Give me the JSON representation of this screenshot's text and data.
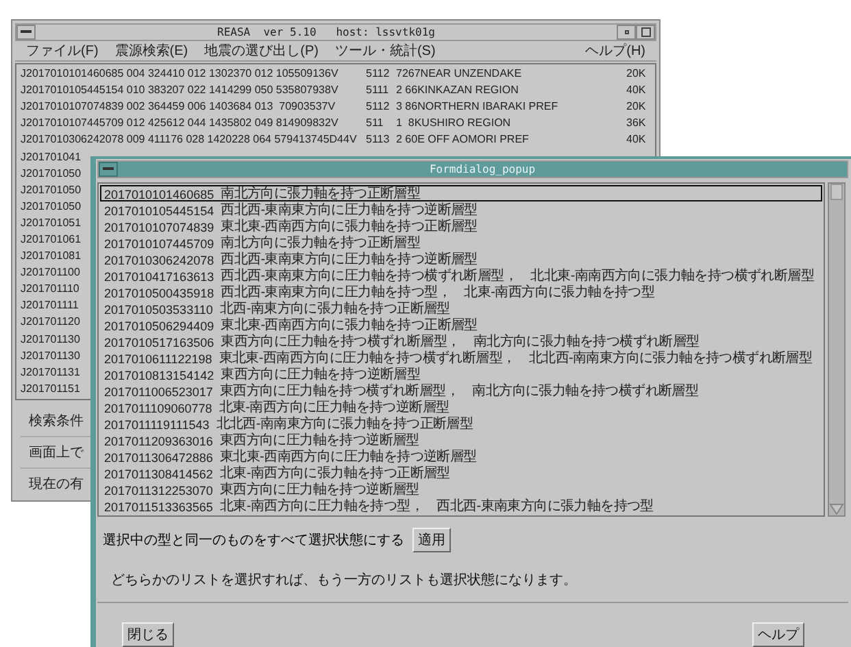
{
  "main_window": {
    "title": "REASA  ver 5.10   host: lssvtk01g",
    "menu": [
      {
        "label": "ファイル(F)"
      },
      {
        "label": "震源検索(E)"
      },
      {
        "label": "地震の選び出し(P)"
      },
      {
        "label": "ツール・統計(S)"
      }
    ],
    "help_menu": "ヘルプ(H)",
    "rows": [
      {
        "kind": "full",
        "data": "J2017010101460685 004 324410 012 1302370 012 105509136V",
        "code": "5112",
        "region": "7267NEAR UNZENDAKE",
        "size": "20K"
      },
      {
        "kind": "full",
        "data": "J2017010105445154 010 383207 022 1414299 050 535807938V",
        "code": "5111",
        "region": "2 66KINKAZAN REGION",
        "size": "40K"
      },
      {
        "kind": "full",
        "data": "J2017010107074839 002 364459 006 1403684 013  70903537V",
        "code": "5112",
        "region": "3 86NORTHERN IBARAKI PREF",
        "size": "20K"
      },
      {
        "kind": "full",
        "data": "J2017010107445709 012 425612 044 1435802 049 814909832V",
        "code": "511",
        "region": "1  8KUSHIRO REGION",
        "size": "36K"
      },
      {
        "kind": "full",
        "data": "J2017010306242078 009 411176 028 1420228 064 579413745D44V",
        "code": "5113",
        "region": "2 60E OFF AOMORI PREF",
        "size": "40K"
      },
      {
        "kind": "partial",
        "data": "J201701041"
      },
      {
        "kind": "partial",
        "data": "J201701050"
      },
      {
        "kind": "partial",
        "data": "J201701050"
      },
      {
        "kind": "partial",
        "data": "J201701050"
      },
      {
        "kind": "partial",
        "data": "J201701051"
      },
      {
        "kind": "partial",
        "data": "J201701061"
      },
      {
        "kind": "partial",
        "data": "J201701081"
      },
      {
        "kind": "partial",
        "data": "J201701100"
      },
      {
        "kind": "partial",
        "data": "J201701110"
      },
      {
        "kind": "partial",
        "data": "J201701111"
      },
      {
        "kind": "partial",
        "data": "J201701120"
      },
      {
        "kind": "partial",
        "data": "J201701130"
      },
      {
        "kind": "partial",
        "data": "J201701130"
      },
      {
        "kind": "partial",
        "data": "J201701131"
      },
      {
        "kind": "partial",
        "data": "J201701151"
      }
    ],
    "labels": [
      "検索条件",
      "画面上で",
      "現在の有"
    ]
  },
  "popup": {
    "title": "Formdialog_popup",
    "rows": [
      {
        "id": "2017010101460685",
        "type": "南北方向に張力軸を持つ正断層型",
        "focused": true
      },
      {
        "id": "2017010105445154",
        "type": "西北西-東南東方向に圧力軸を持つ逆断層型",
        "focused": false
      },
      {
        "id": "2017010107074839",
        "type": "東北東-西南西方向に張力軸を持つ正断層型",
        "focused": false
      },
      {
        "id": "2017010107445709",
        "type": "南北方向に張力軸を持つ正断層型",
        "focused": false
      },
      {
        "id": "2017010306242078",
        "type": "西北西-東南東方向に圧力軸を持つ逆断層型",
        "focused": false
      },
      {
        "id": "2017010417163613",
        "type": "西北西-東南東方向に圧力軸を持つ横ずれ断層型，　北北東-南南西方向に張力軸を持つ横ずれ断層型",
        "focused": false
      },
      {
        "id": "2017010500435918",
        "type": "西北西-東南東方向に圧力軸を持つ型，　北東-南西方向に張力軸を持つ型",
        "focused": false
      },
      {
        "id": "2017010503533110",
        "type": "北西-南東方向に張力軸を持つ正断層型",
        "focused": false
      },
      {
        "id": "2017010506294409",
        "type": "東北東-西南西方向に張力軸を持つ正断層型",
        "focused": false
      },
      {
        "id": "2017010517163506",
        "type": "東西方向に圧力軸を持つ横ずれ断層型，　南北方向に張力軸を持つ横ずれ断層型",
        "focused": false
      },
      {
        "id": "2017010611122198",
        "type": "東北東-西南西方向に圧力軸を持つ横ずれ断層型，　北北西-南南東方向に張力軸を持つ横ずれ断層型",
        "focused": false
      },
      {
        "id": "2017010813154142",
        "type": "東西方向に圧力軸を持つ逆断層型",
        "focused": false
      },
      {
        "id": "2017011006523017",
        "type": "東西方向に圧力軸を持つ横ずれ断層型，　南北方向に張力軸を持つ横ずれ断層型",
        "focused": false
      },
      {
        "id": "2017011109060778",
        "type": "北東-南西方向に圧力軸を持つ逆断層型",
        "focused": false
      },
      {
        "id": "2017011119111543",
        "type": "北北西-南南東方向に張力軸を持つ正断層型",
        "focused": false
      },
      {
        "id": "2017011209363016",
        "type": "東西方向に圧力軸を持つ逆断層型",
        "focused": false
      },
      {
        "id": "2017011306472886",
        "type": "東北東-西南西方向に圧力軸を持つ逆断層型",
        "focused": false
      },
      {
        "id": "2017011308414562",
        "type": "北東-南西方向に張力軸を持つ正断層型",
        "focused": false
      },
      {
        "id": "2017011312253070",
        "type": "東西方向に圧力軸を持つ逆断層型",
        "focused": false
      },
      {
        "id": "2017011513363565",
        "type": "北東-南西方向に圧力軸を持つ型，　西北西-東南東方向に張力軸を持つ型",
        "focused": false
      }
    ],
    "apply_label": "選択中の型と同一のものをすべて選択状態にする",
    "apply_button": "適用",
    "hint": "どちらかのリストを選択すれば、もう一方のリストも選択状態になります。",
    "close_button": "閉じる",
    "help_button": "ヘルプ"
  }
}
